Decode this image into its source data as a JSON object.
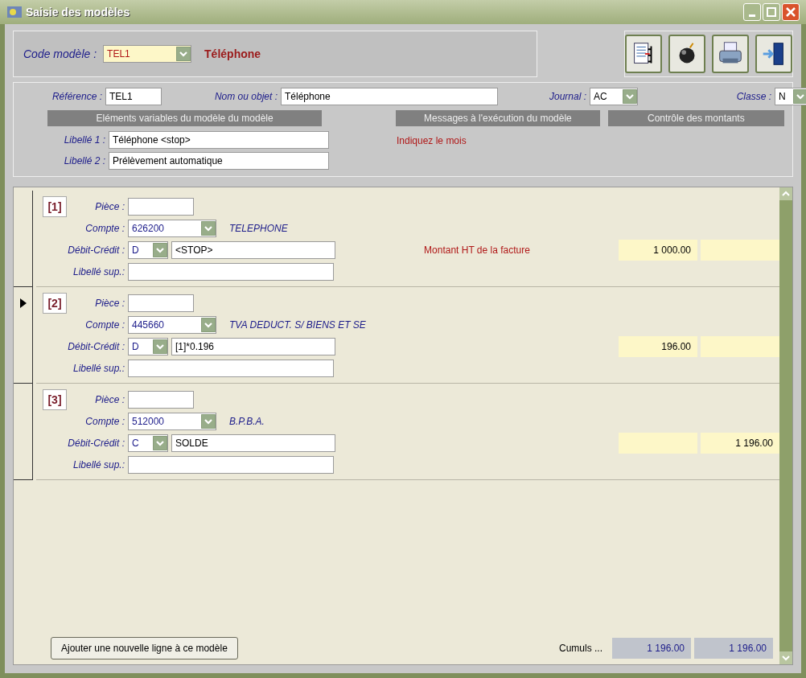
{
  "window": {
    "title": "Saisie des modèles"
  },
  "header": {
    "code_label": "Code modèle :",
    "code_value": "TEL1",
    "code_name": "Téléphone"
  },
  "fields": {
    "reference": {
      "label": "Référence :",
      "value": "TEL1"
    },
    "nom": {
      "label": "Nom ou objet :",
      "value": "Téléphone"
    },
    "journal": {
      "label": "Journal :",
      "value": "AC"
    },
    "classe": {
      "label": "Classe :",
      "value": "N"
    }
  },
  "sections": [
    "Eléments variables du modèle du modèle",
    "Messages à l'exécution du modèle",
    "Contrôle des montants"
  ],
  "libelles": [
    {
      "label": "Libellé 1 :",
      "value": "Téléphone <stop>"
    },
    {
      "label": "Libellé 2 :",
      "value": "Prélèvement automatique"
    }
  ],
  "message": "Indiquez le mois",
  "lines": [
    {
      "index": "[1]",
      "selected": false,
      "piece_label": "Pièce :",
      "compte_label": "Compte :",
      "compte": "626200",
      "compte_name": "TELEPHONE",
      "dc_label": "Débit-Crédit :",
      "dc": "D",
      "formula": "<STOP>",
      "libelle_label": "Libellé sup.:",
      "message": "Montant HT de la facture",
      "debit": "1 000.00"
    },
    {
      "index": "[2]",
      "selected": true,
      "piece_label": "Pièce :",
      "compte_label": "Compte :",
      "compte": "445660",
      "compte_name": "TVA DEDUCT. S/ BIENS ET SE",
      "dc_label": "Débit-Crédit :",
      "dc": "D",
      "formula": "[1]*0.196",
      "libelle_label": "Libellé sup.:",
      "debit": "196.00"
    },
    {
      "index": "[3]",
      "selected": false,
      "piece_label": "Pièce :",
      "compte_label": "Compte :",
      "compte": "512000",
      "compte_name": "B.P.B.A.",
      "dc_label": "Débit-Crédit :",
      "dc": "C",
      "formula": "SOLDE",
      "libelle_label": "Libellé sup.:",
      "credit": "1 196.00"
    }
  ],
  "footer": {
    "add_button": "Ajouter une nouvelle ligne à ce modèle",
    "cumuls_label": "Cumuls ...",
    "cumul_debit": "1 196.00",
    "cumul_credit": "1 196.00"
  }
}
